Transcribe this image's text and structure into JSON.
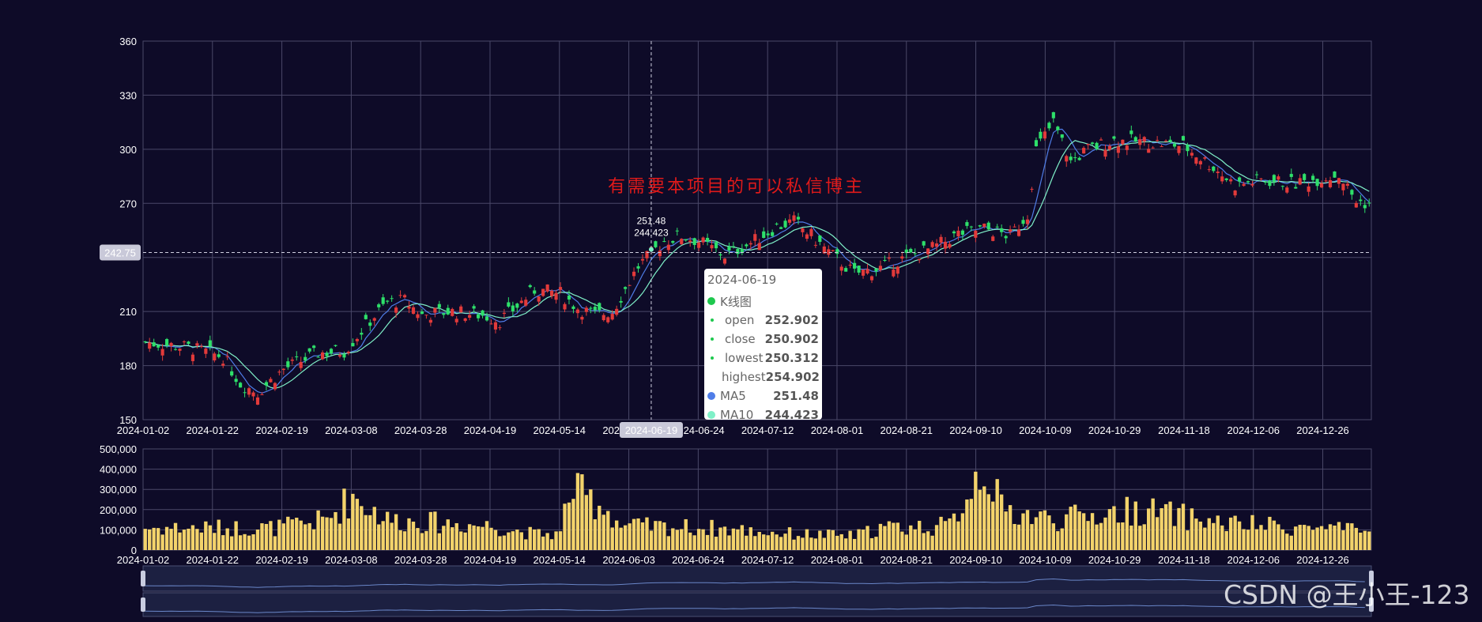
{
  "annotation": "有需要本项目的可以私信博主",
  "watermark": "CSDN @王小王-123",
  "colors": {
    "background": "#0e0b28",
    "grid": "#4a4868",
    "up": "#e23a3a",
    "down": "#2ee06a",
    "ma5": "#4f7de8",
    "ma10": "#7ff0c8",
    "volume": "#f3d36b",
    "axis_text": "#ffffff"
  },
  "crosshair": {
    "x_label": "2024-06-19",
    "y_label": "242.75",
    "point_label_ma5": "251.48",
    "point_label_ma10": "244.423"
  },
  "tooltip": {
    "date": "2024-06-19",
    "series_name": "K线图",
    "rows": [
      {
        "label": "open",
        "value": "252.902"
      },
      {
        "label": "close",
        "value": "250.902"
      },
      {
        "label": "lowest",
        "value": "250.312"
      },
      {
        "label": "highest",
        "value": "254.902"
      }
    ],
    "ma5": {
      "label": "MA5",
      "value": "251.48"
    },
    "ma10": {
      "label": "MA10",
      "value": "244.423"
    }
  },
  "chart_data": {
    "type": "candlestick",
    "x_tick_labels": [
      "2024-01-02",
      "2024-01-22",
      "2024-02-19",
      "2024-03-08",
      "2024-03-28",
      "2024-04-19",
      "2024-05-14",
      "2024-06-03",
      "2024-06-24",
      "2024-07-12",
      "2024-08-01",
      "2024-08-21",
      "2024-09-10",
      "2024-10-09",
      "2024-10-29",
      "2024-11-18",
      "2024-12-06",
      "2024-12-26"
    ],
    "price_axis": {
      "ticks": [
        150,
        180,
        210,
        240,
        270,
        300,
        330,
        360
      ],
      "labels": [
        "150",
        "180",
        "210",
        "",
        "270",
        "300",
        "330",
        "360"
      ],
      "ylim": [
        150,
        360
      ]
    },
    "volume_axis": {
      "ticks": [
        0,
        100000,
        200000,
        300000,
        400000,
        500000
      ],
      "labels": [
        "0",
        "100,000",
        "200,000",
        "300,000",
        "400,000",
        "500,000"
      ],
      "ylim": [
        0,
        500000
      ]
    },
    "trading_days": 242,
    "price_anchors": [
      [
        0,
        193
      ],
      [
        10,
        190
      ],
      [
        18,
        185
      ],
      [
        22,
        170
      ],
      [
        26,
        165
      ],
      [
        32,
        178
      ],
      [
        40,
        187
      ],
      [
        46,
        188
      ],
      [
        52,
        205
      ],
      [
        56,
        215
      ],
      [
        60,
        216
      ],
      [
        64,
        208
      ],
      [
        70,
        210
      ],
      [
        78,
        208
      ],
      [
        82,
        205
      ],
      [
        86,
        213
      ],
      [
        90,
        222
      ],
      [
        96,
        220
      ],
      [
        100,
        212
      ],
      [
        104,
        208
      ],
      [
        108,
        210
      ],
      [
        114,
        235
      ],
      [
        120,
        249
      ],
      [
        124,
        252
      ],
      [
        128,
        249
      ],
      [
        134,
        241
      ],
      [
        140,
        248
      ],
      [
        146,
        257
      ],
      [
        150,
        260
      ],
      [
        154,
        252
      ],
      [
        158,
        243
      ],
      [
        164,
        231
      ],
      [
        170,
        234
      ],
      [
        176,
        240
      ],
      [
        182,
        245
      ],
      [
        188,
        253
      ],
      [
        194,
        256
      ],
      [
        200,
        252
      ],
      [
        204,
        264
      ],
      [
        206,
        300
      ],
      [
        210,
        315
      ],
      [
        214,
        293
      ],
      [
        218,
        300
      ],
      [
        224,
        305
      ],
      [
        232,
        304
      ],
      [
        240,
        302
      ],
      [
        246,
        292
      ],
      [
        252,
        280
      ],
      [
        258,
        283
      ],
      [
        266,
        281
      ],
      [
        272,
        284
      ],
      [
        276,
        286
      ],
      [
        280,
        271
      ],
      [
        283,
        270
      ]
    ],
    "volume_anchors": [
      [
        0,
        110000
      ],
      [
        30,
        110000
      ],
      [
        42,
        150000
      ],
      [
        48,
        270000
      ],
      [
        56,
        150000
      ],
      [
        80,
        120000
      ],
      [
        90,
        80000
      ],
      [
        96,
        80000
      ],
      [
        98,
        300000
      ],
      [
        106,
        220000
      ],
      [
        110,
        120000
      ],
      [
        130,
        110000
      ],
      [
        150,
        80000
      ],
      [
        164,
        70000
      ],
      [
        170,
        110000
      ],
      [
        186,
        120000
      ],
      [
        194,
        440000
      ],
      [
        198,
        200000
      ],
      [
        210,
        150000
      ],
      [
        230,
        200000
      ],
      [
        250,
        130000
      ],
      [
        270,
        110000
      ],
      [
        283,
        90000
      ]
    ],
    "highlight_index": 117
  }
}
